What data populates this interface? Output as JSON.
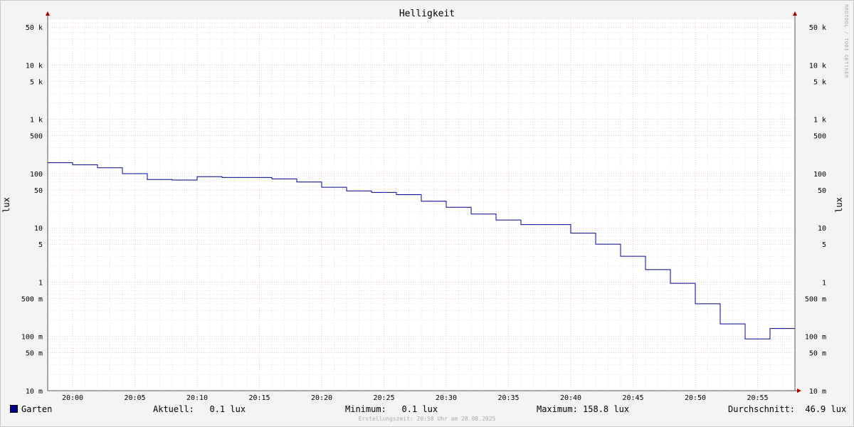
{
  "chart_data": {
    "type": "line",
    "title": "Helligkeit",
    "ylabel": "lux",
    "y_scale": "log",
    "ylim": [
      0.01,
      70000
    ],
    "xlim": [
      "19:58",
      "20:58"
    ],
    "grid": true,
    "y_ticks": [
      {
        "value": 50000,
        "label": "50 k"
      },
      {
        "value": 10000,
        "label": "10 k"
      },
      {
        "value": 5000,
        "label": "5 k"
      },
      {
        "value": 1000,
        "label": "1 k"
      },
      {
        "value": 500,
        "label": "500"
      },
      {
        "value": 100,
        "label": "100"
      },
      {
        "value": 50,
        "label": "50"
      },
      {
        "value": 10,
        "label": "10"
      },
      {
        "value": 5,
        "label": "5"
      },
      {
        "value": 1,
        "label": "1"
      },
      {
        "value": 0.5,
        "label": "500 m"
      },
      {
        "value": 0.1,
        "label": "100 m"
      },
      {
        "value": 0.05,
        "label": "50 m"
      },
      {
        "value": 0.01,
        "label": "10 m"
      }
    ],
    "x_ticks": [
      "20:00",
      "20:05",
      "20:10",
      "20:15",
      "20:20",
      "20:25",
      "20:30",
      "20:35",
      "20:40",
      "20:45",
      "20:50",
      "20:55"
    ],
    "series": [
      {
        "name": "Garten",
        "color": "#00008b",
        "step": true,
        "x": [
          "19:58",
          "20:00",
          "20:02",
          "20:04",
          "20:06",
          "20:08",
          "20:10",
          "20:12",
          "20:14",
          "20:16",
          "20:18",
          "20:20",
          "20:22",
          "20:24",
          "20:26",
          "20:28",
          "20:30",
          "20:32",
          "20:34",
          "20:36",
          "20:38",
          "20:40",
          "20:42",
          "20:44",
          "20:46",
          "20:48",
          "20:50",
          "20:52",
          "20:54",
          "20:56",
          "20:58"
        ],
        "values": [
          158.8,
          145,
          128,
          100,
          78,
          76,
          88,
          85,
          85,
          80,
          70,
          56,
          48,
          45,
          41,
          31,
          24,
          18,
          14,
          11.5,
          11.5,
          8,
          5,
          3,
          1.7,
          0.95,
          0.4,
          0.17,
          0.09,
          0.14,
          0.14
        ]
      }
    ]
  },
  "watermark": "RRDTOOL / TOBI OETIKER",
  "legend": {
    "series_name": "Garten",
    "swatch_color": "#00008b",
    "current": "Aktuell:   0.1 lux",
    "minimum": "Minimum:   0.1 lux",
    "maximum": "Maximum: 158.8 lux",
    "average": "Durchschnitt:  46.9 lux"
  },
  "footer": "Erstellungszeit: 20:58 Uhr am 28.08.2025"
}
